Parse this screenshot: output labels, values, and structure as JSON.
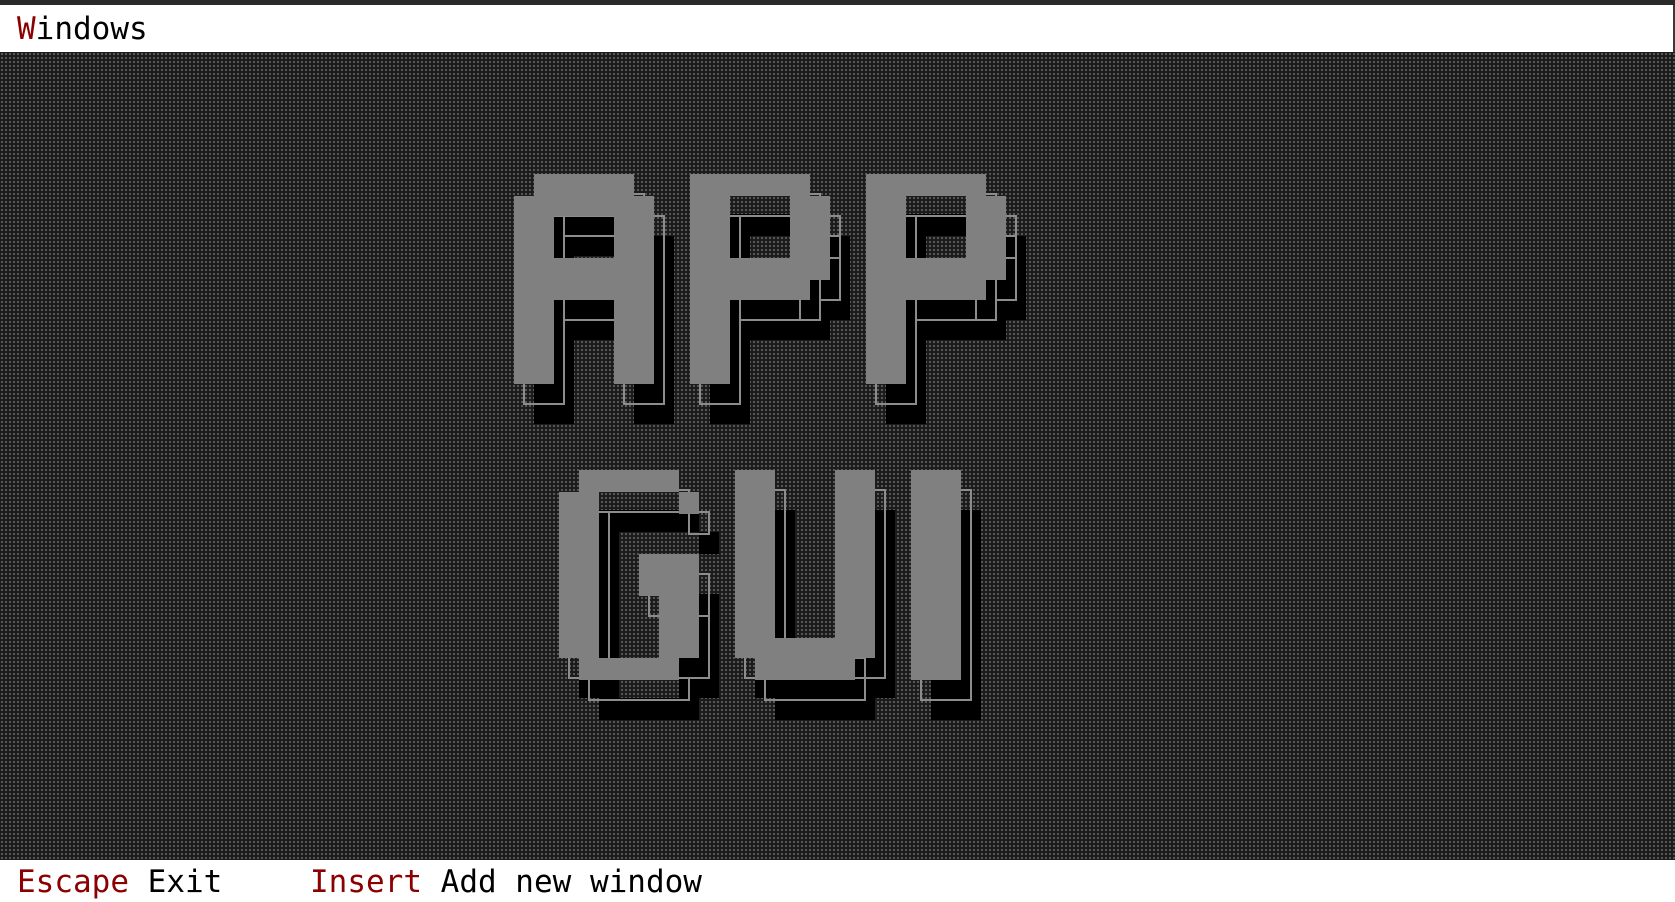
{
  "menubar": {
    "items": [
      {
        "hotkey": "W",
        "rest": "indows"
      }
    ]
  },
  "desktop": {
    "logo": {
      "lines": [
        "APP",
        "GUI"
      ],
      "colors": {
        "face": "#808080",
        "shadow": "#000000",
        "outline": "#8c8c8c"
      }
    }
  },
  "statusbar": {
    "items": [
      {
        "key": "Escape",
        "label": "Exit"
      },
      {
        "key": "Insert",
        "label": "Add new window"
      }
    ]
  },
  "colors": {
    "hotkey": "#8b0000",
    "desktop_background": "#1c1c1c",
    "menubar_background": "#ffffff"
  }
}
